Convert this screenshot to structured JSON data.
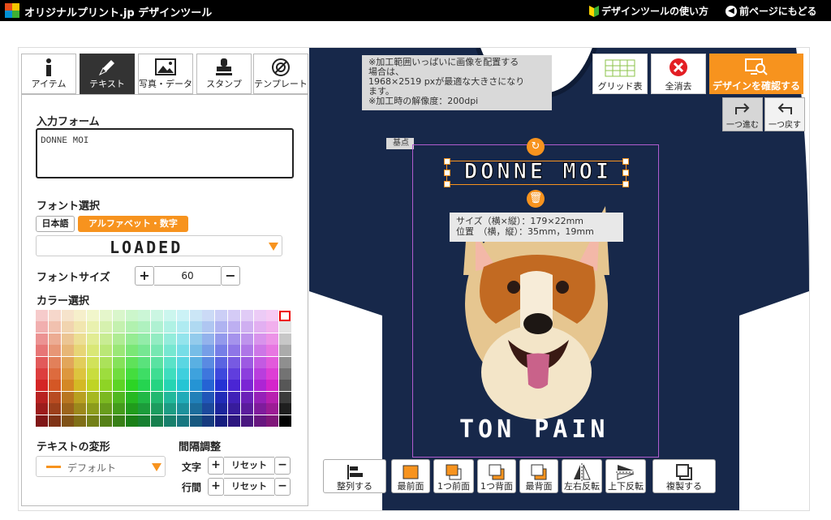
{
  "header": {
    "brand": "オリジナルプリント.jp デザインツール",
    "howto": "デザインツールの使い方",
    "back": "前ページにもどる"
  },
  "tabs": [
    {
      "label": "アイテム",
      "icon": "info-icon"
    },
    {
      "label": "テキスト",
      "icon": "pen-icon"
    },
    {
      "label": "写真・データ",
      "icon": "image-icon"
    },
    {
      "label": "スタンプ",
      "icon": "stamp-icon"
    },
    {
      "label": "テンプレート",
      "icon": "compass-icon"
    }
  ],
  "panel": {
    "input_label": "入力フォーム",
    "input_value": "DONNE MOI",
    "font_label": "フォント選択",
    "lang_ja": "日本語",
    "lang_en": "アルファベット・数字",
    "font_name": "LOADED",
    "fontsize_label": "フォントサイズ",
    "fontsize_value": "60",
    "plus": "+",
    "minus": "−",
    "color_label": "カラー選択",
    "transform_label": "テキストの変形",
    "transform_value": "デフォルト",
    "spacing_label": "間隔調整",
    "spacing_char": "文字",
    "spacing_line": "行間",
    "reset": "リセット"
  },
  "canvas": {
    "notice": [
      "※加工範囲いっぱいに画像を配置する",
      "場合は、",
      "1968×2519 pxが最適な大きさになり",
      "ます。",
      "※加工時の解像度：200dpi"
    ],
    "kiten": "基点",
    "design_text": "DONNE MOI",
    "info_size": "サイズ（横×縦）：179×22mm",
    "info_pos": "位置　（横，縦）：35mm，19mm",
    "bottom_text": "TON PAIN",
    "shirt_color": "#17284a"
  },
  "tools": {
    "grid": "グリッド表",
    "clear": "全消去",
    "confirm": "デザインを確認する",
    "redo": "一つ進む",
    "undo": "一つ戻す"
  },
  "bottom": [
    {
      "label": "整列する",
      "icon": "align-icon"
    },
    {
      "label": "最前面",
      "icon": "front-icon"
    },
    {
      "label": "1つ前面",
      "icon": "forward-icon"
    },
    {
      "label": "1つ背面",
      "icon": "backward-icon"
    },
    {
      "label": "最背面",
      "icon": "back-icon"
    },
    {
      "label": "左右反転",
      "icon": "flip-h-icon"
    },
    {
      "label": "上下反転",
      "icon": "flip-v-icon"
    },
    {
      "label": "複製する",
      "icon": "duplicate-icon"
    }
  ]
}
